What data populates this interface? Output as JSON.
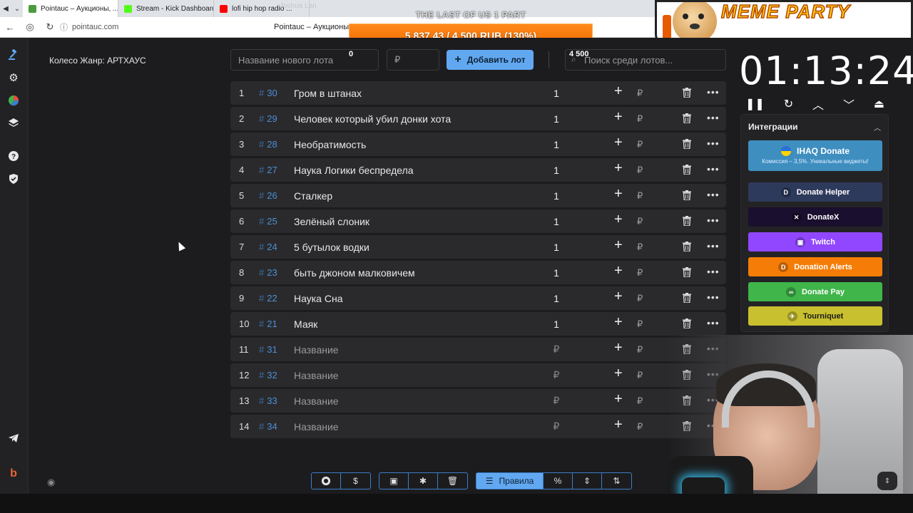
{
  "browser": {
    "tabs": [
      {
        "title": "Pointauc – Аукционы, ...",
        "favicon_color": "#4a9c3c"
      },
      {
        "title": "Stream - Kick Dashboard",
        "favicon_color": "#53fc18"
      },
      {
        "title": "lofi hip hop radio ...",
        "favicon_color": "#ff0000"
      }
    ],
    "url": "pointauc.com",
    "page_title": "Pointauc – Аукционы, л"
  },
  "overlay": {
    "stream_title": "THE LAST OF US 1 PART",
    "viewer_name": "Joshua Lan",
    "donation_progress": "5 837.43 / 4 500 RUB (130%)",
    "donation_progress_fraction": 1.3,
    "meme_text": "MEME PARTY"
  },
  "sidebar": {
    "icons": [
      "gavel-icon",
      "gear-icon",
      "pie-chart-icon",
      "layers-icon",
      "help-icon",
      "shield-icon",
      "telegram-icon",
      "brand-icon"
    ]
  },
  "wheel": {
    "label": "Колесо Жанр: АРТХАУС"
  },
  "toolbar": {
    "new_lot_placeholder": "Название нового лота",
    "amount_placeholder": "₽",
    "add_button_label": "Добавить лот",
    "search_placeholder": "Поиск среди лотов...",
    "stat_left": "0",
    "stat_right": "4 500"
  },
  "lots": [
    {
      "index": "1",
      "id": "30",
      "name": "Гром в штанах",
      "amount": "1",
      "placeholder": false
    },
    {
      "index": "2",
      "id": "29",
      "name": "Человек который убил донки хота",
      "amount": "1",
      "placeholder": false
    },
    {
      "index": "3",
      "id": "28",
      "name": "Необратимость",
      "amount": "1",
      "placeholder": false
    },
    {
      "index": "4",
      "id": "27",
      "name": "Наука Логики беспредела",
      "amount": "1",
      "placeholder": false
    },
    {
      "index": "5",
      "id": "26",
      "name": "Сталкер",
      "amount": "1",
      "placeholder": false
    },
    {
      "index": "6",
      "id": "25",
      "name": "Зелёный слоник",
      "amount": "1",
      "placeholder": false
    },
    {
      "index": "7",
      "id": "24",
      "name": "5 бутылок водки",
      "amount": "1",
      "placeholder": false
    },
    {
      "index": "8",
      "id": "23",
      "name": "быть джоном малковичем",
      "amount": "1",
      "placeholder": false
    },
    {
      "index": "9",
      "id": "22",
      "name": "Наука Сна",
      "amount": "1",
      "placeholder": false
    },
    {
      "index": "10",
      "id": "21",
      "name": "Маяк",
      "amount": "1",
      "placeholder": false
    },
    {
      "index": "11",
      "id": "31",
      "name": "Название",
      "amount": "₽",
      "placeholder": true
    },
    {
      "index": "12",
      "id": "32",
      "name": "Название",
      "amount": "₽",
      "placeholder": true
    },
    {
      "index": "13",
      "id": "33",
      "name": "Название",
      "amount": "₽",
      "placeholder": true
    },
    {
      "index": "14",
      "id": "34",
      "name": "Название",
      "amount": "₽",
      "placeholder": true
    }
  ],
  "row_labels": {
    "hash": "#",
    "plus": "+",
    "rub": "₽",
    "more": "•••"
  },
  "timer": {
    "value": "01:13:24",
    "controls": [
      "pause-icon",
      "reset-icon",
      "chevron-up-icon",
      "chevron-down-icon",
      "eject-icon"
    ]
  },
  "integrations": {
    "title": "Интеграции",
    "ihaq": {
      "label": "IHAQ Donate",
      "subtitle": "Комиссия – 3,5%. Уникальные виджеты!",
      "color": "#3f8ec0"
    },
    "buttons": [
      {
        "label": "Donate Helper",
        "color": "#2e3a5c"
      },
      {
        "label": "DonateX",
        "color": "#1a0f2e"
      },
      {
        "label": "Twitch",
        "color": "#9147ff"
      },
      {
        "label": "Donation Alerts",
        "color": "#f57d07"
      },
      {
        "label": "Donate Pay",
        "color": "#3fb54a"
      },
      {
        "label": "Tourniquet",
        "color": "#c9c02f"
      }
    ]
  },
  "bottom": {
    "group1": [
      "github-icon",
      "dollar-icon"
    ],
    "group2": [
      "save-icon",
      "bug-icon",
      "clear-icon"
    ],
    "rules_label": "Правила",
    "group3": [
      "percent-icon",
      "compress-icon",
      "sort-icon"
    ]
  }
}
